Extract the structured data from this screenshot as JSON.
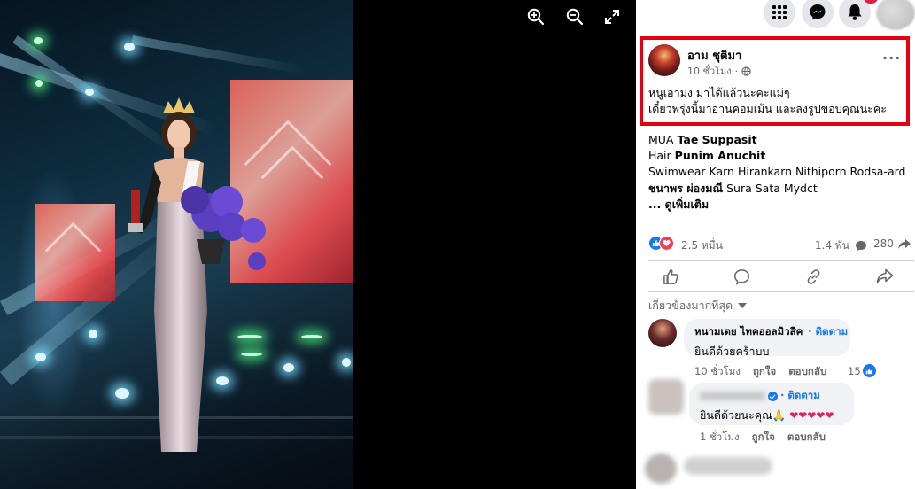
{
  "viewer": {
    "zoom_in_icon": "magnifier-plus-icon",
    "zoom_out_icon": "magnifier-minus-icon",
    "fullscreen_icon": "expand-arrows-icon",
    "photo_alt": "Woman in crown and sequined gown holding purple bouquet and trophy on stage"
  },
  "topbar": {
    "menu_icon": "grid-menu-icon",
    "messenger_icon": "messenger-icon",
    "notifications_icon": "bell-icon"
  },
  "post": {
    "author": "อาม ชุติมา",
    "time": "10 ชั่วโมง",
    "privacy_icon": "globe-icon",
    "more_label": "···",
    "caption_line1": "หนูเอามง มาได้แล้วนะคะแม่ๆ",
    "caption_line2": "เดี๋ยวพรุ่งนี้มาอ่านคอมเม้น และลงรูปขอบคุณนะคะ",
    "credits": [
      {
        "prefix": "MUA ",
        "bold": "Tae Suppasit",
        "rest": ""
      },
      {
        "prefix": "Hair ",
        "bold": "Punim Anuchit",
        "rest": ""
      },
      {
        "prefix": "Swimwear Karn Hirankarn Nithiporn Rodsa-ard",
        "bold": "",
        "rest": ""
      },
      {
        "prefix": "",
        "bold": "ชนาพร ผ่องมณี",
        "rest": " Sura Sata Mydct"
      },
      {
        "prefix": "",
        "bold": "... ดูเพิ่มเติม",
        "rest": ""
      }
    ],
    "reaction_count": "2.5 หมื่น",
    "comment_count": "1.4 พัน",
    "share_count": "280"
  },
  "actions": {
    "like_icon": "thumbs-up-icon",
    "comment_icon": "speech-bubble-icon",
    "copy_link_icon": "link-icon",
    "share_icon": "share-arrow-icon"
  },
  "comments_sort": "เกี่ยวข้องมากที่สุด",
  "comments": [
    {
      "name": "หนามเตย ไทคออลมิวสิค",
      "follow": "· ติดตาม",
      "text": "ยินดีด้วยคร้าบบ",
      "time": "10 ชั่วโมง",
      "like": "ถูกใจ",
      "reply": "ตอบกลับ",
      "reactions": "15"
    },
    {
      "name": "",
      "follow": "· ติดตาม",
      "text": "ยินดีด้วยนะคุณ🙏 ",
      "time": "1 ชั่วโมง",
      "like": "ถูกใจ",
      "reply": "ตอบกลับ"
    }
  ],
  "colors": {
    "highlight": "#e5000f",
    "link_blue": "#1877f2",
    "love_red": "#f33e58"
  }
}
